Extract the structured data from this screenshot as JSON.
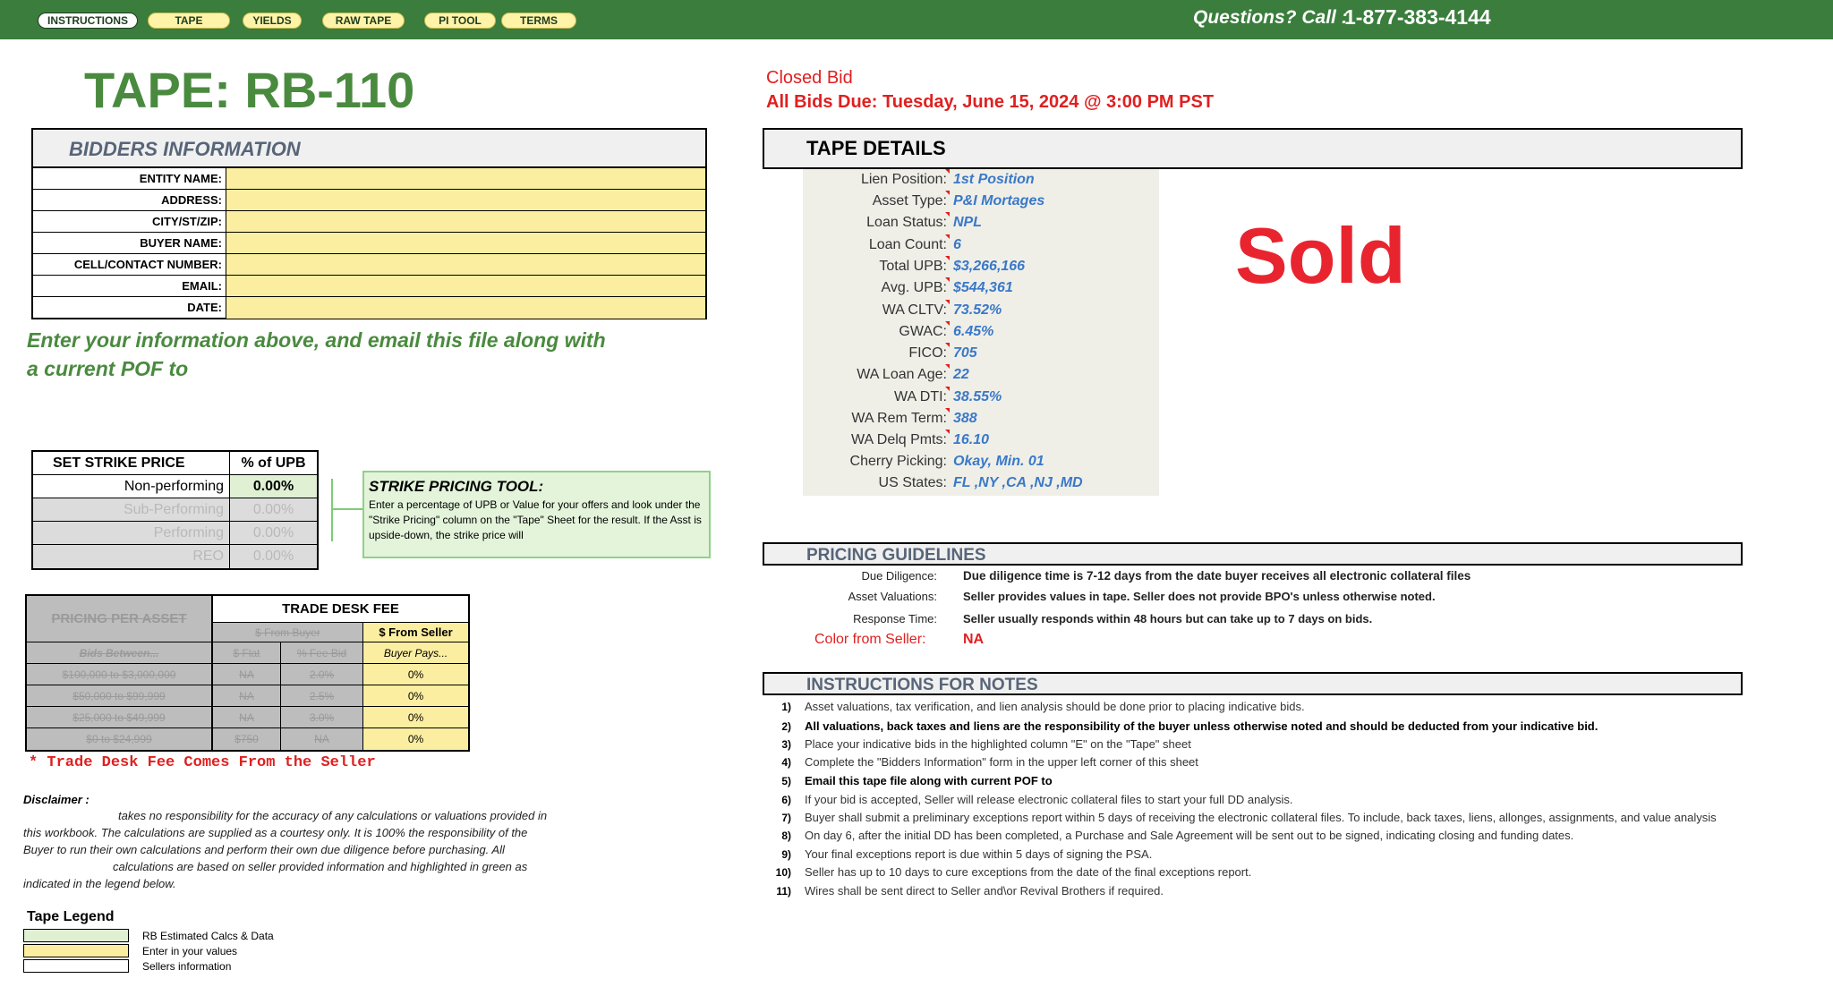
{
  "nav": {
    "tabs": [
      "INSTRUCTIONS",
      "TAPE",
      "YIELDS",
      "RAW TAPE",
      "PI TOOL",
      "TERMS"
    ],
    "phone_label": "Questions? Call :",
    "phone_number": "1-877-383-4144"
  },
  "tape_title": "TAPE: RB-110",
  "bidders": {
    "title": "BIDDERS INFORMATION",
    "fields": [
      "ENTITY NAME:",
      "ADDRESS:",
      "CITY/ST/ZIP:",
      "BUYER NAME:",
      "CELL/CONTACT NUMBER:",
      "EMAIL:",
      "DATE:"
    ],
    "note_line1": "Enter your information above, and email this file along with",
    "note_line2": "a current POF to"
  },
  "strike": {
    "head_label": "SET STRIKE PRICE",
    "head_value": "% of UPB",
    "rows": [
      {
        "label": "Non-performing",
        "value": "0.00%"
      },
      {
        "label": "Sub-Performing",
        "value": "0.00%"
      },
      {
        "label": "Performing",
        "value": "0.00%"
      },
      {
        "label": "REO",
        "value": "0.00%"
      }
    ],
    "tool_title": "STRIKE PRICING TOOL:",
    "tool_text": "Enter a percentage of UPB or Value for your offers and look under the \"Strike Pricing\" column on the \"Tape\" Sheet for the result. If the Asst is upside-down, the strike price will"
  },
  "trade": {
    "pricing_per_asset": "PRICING PER ASSET",
    "trade_desk_fee": "TRADE DESK FEE",
    "from_buyer": "$ From Buyer",
    "from_seller": "$ From Seller",
    "bids_between": "Bids Between...",
    "flat": "$ Flat",
    "fee_bid": "% Fee Bid",
    "buyer_pays": "Buyer Pays...",
    "rows": [
      {
        "range": "$100,000 to $3,000,000",
        "flat": "NA",
        "fee": "2.0%",
        "seller": "0%"
      },
      {
        "range": "$50,000 to $99,999",
        "flat": "NA",
        "fee": "2.5%",
        "seller": "0%"
      },
      {
        "range": "$25,000 to $49,999",
        "flat": "NA",
        "fee": "3.0%",
        "seller": "0%"
      },
      {
        "range": "$0 to $24,999",
        "flat": "$750",
        "fee": "NA",
        "seller": "0%"
      }
    ],
    "note": "* Trade Desk Fee Comes From the Seller"
  },
  "disclaimer": {
    "label": "Disclaimer :",
    "line1": "takes no responsibility for the accuracy of any calculations or valuations provided in",
    "line2": "this workbook.  The calculations are supplied as a courtesy only.  It is 100% the responsibility of the",
    "line3": "Buyer to run their own calculations and perform their own due diligence before purchasing.  All",
    "line4": "calculations are based on seller provided information and highlighted in green as",
    "line5": "indicated in the legend below."
  },
  "legend": {
    "title": "Tape Legend",
    "items": [
      "RB Estimated Calcs & Data",
      "Enter in your values",
      "Sellers information"
    ],
    "colors": [
      "#dff0d3",
      "#fbeea0",
      "#ffffff"
    ]
  },
  "bid_status": {
    "closed": "Closed Bid",
    "due": "All Bids Due: Tuesday, June 15, 2024 @ 3:00 PM PST"
  },
  "tape_details": {
    "title": "TAPE DETAILS",
    "rows": [
      {
        "label": "Lien Position:",
        "value": "1st Position"
      },
      {
        "label": "Asset Type:",
        "value": "P&I Mortages"
      },
      {
        "label": "Loan Status:",
        "value": "NPL"
      },
      {
        "label": "Loan Count:",
        "value": "6"
      },
      {
        "label": "Total UPB:",
        "value": "$3,266,166"
      },
      {
        "label": "Avg. UPB:",
        "value": "$544,361"
      },
      {
        "label": "WA CLTV:",
        "value": "73.52%"
      },
      {
        "label": "GWAC:",
        "value": "6.45%"
      },
      {
        "label": "FICO:",
        "value": "705"
      },
      {
        "label": "WA Loan Age:",
        "value": "22"
      },
      {
        "label": "WA DTI:",
        "value": "38.55%"
      },
      {
        "label": "WA Rem Term:",
        "value": "388"
      },
      {
        "label": "WA Delq Pmts:",
        "value": "16.10"
      },
      {
        "label": "Cherry Picking:",
        "value": "Okay, Min. 01"
      },
      {
        "label": "US States:",
        "value": "FL ,NY ,CA ,NJ ,MD"
      }
    ]
  },
  "sold_label": "Sold",
  "pricing_guidelines": {
    "title": "PRICING GUIDELINES",
    "rows": [
      {
        "label": "Due Diligence:",
        "value": "Due diligence time is 7-12 days from the date buyer receives all electronic collateral files"
      },
      {
        "label": "Asset Valuations:",
        "value": "Seller provides values in tape. Seller does not provide BPO's unless otherwise noted."
      },
      {
        "label": "Response Time:",
        "value": "Seller usually responds within 48 hours but can take up to 7 days on bids."
      }
    ],
    "color_label": "Color from Seller:",
    "color_value": "NA"
  },
  "notes": {
    "title": "INSTRUCTIONS FOR NOTES",
    "items": [
      {
        "num": "1)",
        "text": "Asset valuations, tax verification, and lien analysis should be done prior to placing indicative bids.",
        "bold": false
      },
      {
        "num": "2)",
        "text": "All valuations, back taxes and liens are the responsibility of the buyer unless otherwise noted and should be deducted from your indicative bid.",
        "bold": true
      },
      {
        "num": "3)",
        "text": "Place your indicative bids in the highlighted column \"E\" on the \"Tape\" sheet",
        "bold": false
      },
      {
        "num": "4)",
        "text": "Complete the \"Bidders Information\" form in the upper left corner of this sheet",
        "bold": false
      },
      {
        "num": "5)",
        "text": "Email this tape file along with current POF to",
        "bold": true
      },
      {
        "num": "6)",
        "text": "If your bid is accepted, Seller will release electronic collateral files to start your full DD analysis.",
        "bold": false
      },
      {
        "num": "7)",
        "text": "Buyer shall submit a preliminary exceptions report within 5 days of receiving the electronic collateral files. To include, back taxes, liens, allonges, assignments, and value analysis",
        "bold": false
      },
      {
        "num": "8)",
        "text": "On day 6, after the initial DD has been completed, a Purchase and Sale Agreement will be sent out to be signed, indicating closing and funding dates.",
        "bold": false
      },
      {
        "num": "9)",
        "text": "Your final exceptions report is due within 5 days of signing the PSA.",
        "bold": false
      },
      {
        "num": "10)",
        "text": "Seller has up to 10 days to cure exceptions from the date of the final exceptions report.",
        "bold": false
      },
      {
        "num": "11)",
        "text": "Wires shall be sent direct to Seller and\\or Revival Brothers if required.",
        "bold": false
      }
    ]
  }
}
